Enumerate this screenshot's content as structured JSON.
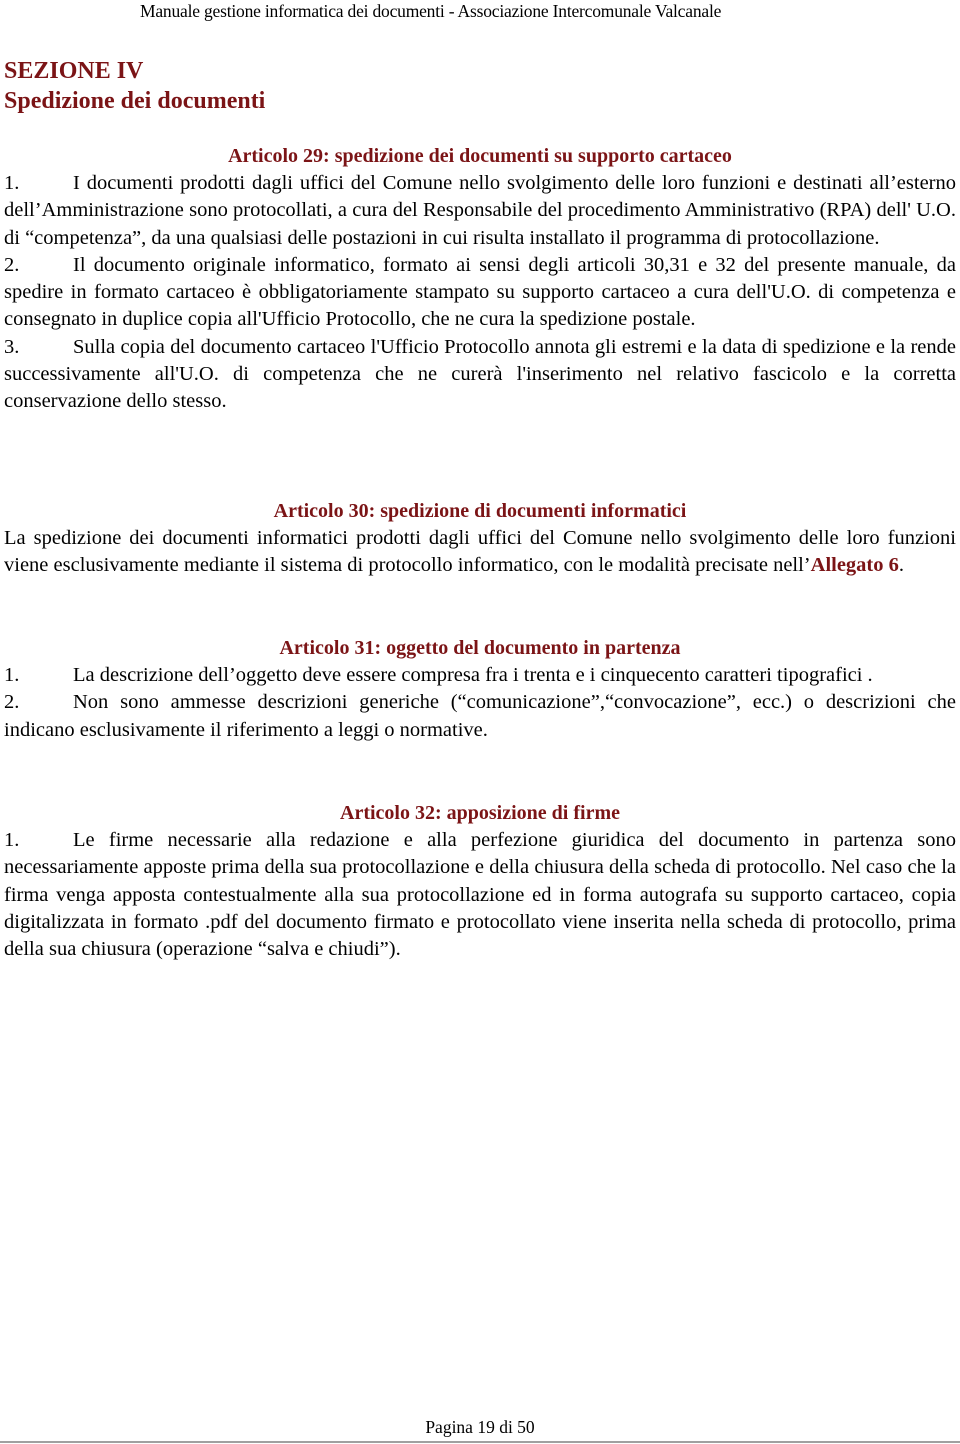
{
  "header": {
    "running_title": "Manuale gestione informatica dei documenti - Associazione Intercomunale Valcanale"
  },
  "section": {
    "number": "SEZIONE IV",
    "title": "Spedizione dei documenti"
  },
  "articles": [
    {
      "title": "Articolo 29: spedizione dei documenti su supporto cartaceo",
      "paragraphs": [
        {
          "num": "1.",
          "text": "I documenti prodotti dagli uffici del Comune nello svolgimento delle loro funzioni e destinati all’esterno dell’Amministrazione sono protocollati, a cura del Responsabile del procedimento Amministrativo (RPA) dell' U.O. di “competenza”, da una qualsiasi delle postazioni in cui risulta installato il programma di protocollazione."
        },
        {
          "num": "2.",
          "text": "Il documento originale informatico, formato ai sensi degli articoli 30,31 e 32 del presente manuale, da spedire in formato cartaceo è obbligatoriamente stampato su supporto cartaceo a cura dell'U.O. di competenza e consegnato in duplice copia all'Ufficio Protocollo, che ne cura la spedizione postale."
        },
        {
          "num": "3.",
          "text": "Sulla copia del documento cartaceo l'Ufficio Protocollo annota gli estremi e la data di spedizione e la rende successivamente all'U.O. di competenza che ne curerà l'inserimento nel relativo fascicolo e la corretta conservazione dello stesso."
        }
      ]
    },
    {
      "title": "Articolo 30: spedizione di documenti informatici",
      "text_before": "La spedizione dei documenti informatici prodotti dagli uffici del Comune nello svolgimento delle loro funzioni viene esclusivamente mediante il sistema di protocollo informatico, con le modalità precisate nell’",
      "link": "Allegato 6",
      "text_after": "."
    },
    {
      "title": "Articolo 31: oggetto del documento in partenza",
      "paragraphs": [
        {
          "num": "1.",
          "text": "La descrizione dell’oggetto deve essere compresa fra i trenta e i cinquecento caratteri tipografici ."
        },
        {
          "num": "2.",
          "text": "Non sono ammesse descrizioni generiche (“comunicazione”,“convocazione”, ecc.) o descrizioni che indicano esclusivamente il riferimento a leggi o normative."
        }
      ]
    },
    {
      "title": "Articolo 32: apposizione di firme",
      "paragraphs": [
        {
          "num": "1.",
          "text": "Le firme necessarie alla  redazione e alla perfezione  giuridica del  documento in partenza sono necessariamente apposte prima della sua protocollazione e della chiusura della scheda di protocollo. Nel caso che la firma venga apposta contestualmente alla sua protocollazione ed in forma autografa su supporto cartaceo, copia digitalizzata in formato .pdf del documento firmato e protocollato viene inserita nella scheda di protocollo, prima della sua chiusura (operazione “salva e chiudi”)."
        }
      ]
    }
  ],
  "footer": {
    "page_label": "Pagina 19 di 50"
  },
  "colors": {
    "heading": "#7b1416",
    "body_text": "#000000",
    "footer_rule": "#a0a0a0"
  }
}
